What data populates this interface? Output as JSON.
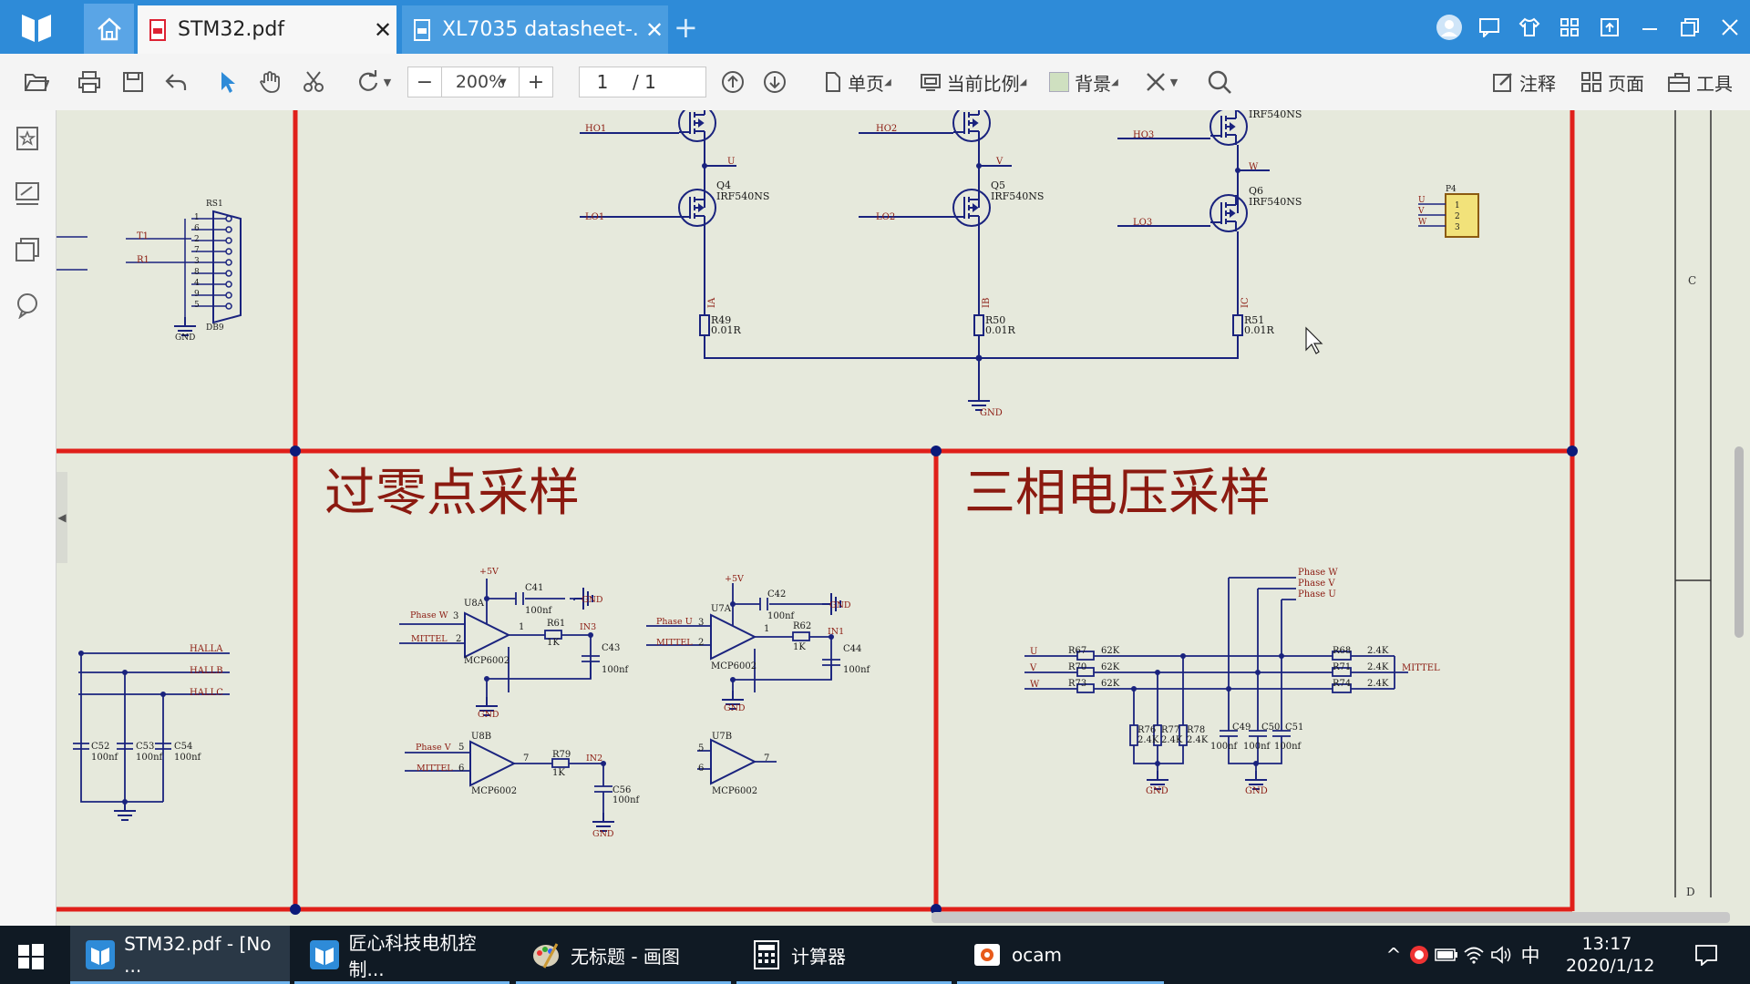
{
  "window": {
    "tabs": [
      {
        "label": "STM32.pdf",
        "active": true
      },
      {
        "label": "XL7035 datasheet-...",
        "active": false
      }
    ],
    "new_tab": "+"
  },
  "toolbar": {
    "zoom_value": "200%",
    "zoom_out": "−",
    "zoom_in": "+",
    "page_current": "1",
    "page_total": "/ 1",
    "single_page": "单页",
    "current_scale": "当前比例",
    "background": "背景",
    "annotate": "注释",
    "page": "页面",
    "tools": "工具"
  },
  "schematic": {
    "sections": {
      "zero_cross": "过零点采样",
      "three_phase": "三相电压采样"
    },
    "mosfets": [
      {
        "ref": "Q4",
        "part": "IRF540NS",
        "gate": "LO1",
        "node": "U"
      },
      {
        "ref": "Q5",
        "part": "IRF540NS",
        "gate": "LO2",
        "node": "V"
      },
      {
        "ref": "Q6",
        "part": "IRF540NS",
        "gate": "LO3",
        "node": "W"
      }
    ],
    "high_gates": [
      "HO1",
      "HO2",
      "HO3"
    ],
    "top_part_label": "IRF540NS",
    "shunts": [
      {
        "ref": "R49",
        "value": "0.01R",
        "net": "IA"
      },
      {
        "ref": "R50",
        "value": "0.01R",
        "net": "IB"
      },
      {
        "ref": "R51",
        "value": "0.01R",
        "net": "IC"
      }
    ],
    "gnd": "GND",
    "connector_db9": {
      "ref": "RS1",
      "part": "DB9",
      "pins": [
        "1",
        "6",
        "2",
        "7",
        "3",
        "8",
        "4",
        "9",
        "5"
      ],
      "t1": "T1",
      "r1": "R1"
    },
    "connector_p4": {
      "ref": "P4",
      "pins": [
        "1",
        "2",
        "3"
      ],
      "nets": [
        "U",
        "V",
        "W"
      ]
    },
    "hall": [
      "HALLA",
      "HALLB",
      "HALLC"
    ],
    "hall_caps": [
      {
        "ref": "C52",
        "value": "100nf"
      },
      {
        "ref": "C53",
        "value": "100nf"
      },
      {
        "ref": "C54",
        "value": "100nf"
      }
    ],
    "opamps": [
      {
        "ref": "U8A",
        "part": "MCP6002",
        "in_plus": "Phase W",
        "in_minus": "MITTEL",
        "pin_plus": "3",
        "pin_minus": "2",
        "out": "1",
        "r": "R61",
        "rv": "1K",
        "net": "IN3",
        "c": "C43",
        "cv": "100nf",
        "dec": "C41",
        "decv": "100nf"
      },
      {
        "ref": "U7A",
        "part": "MCP6002",
        "in_plus": "Phase U",
        "in_minus": "MITTEL",
        "pin_plus": "3",
        "pin_minus": "2",
        "out": "1",
        "r": "R62",
        "rv": "1K",
        "net": "IN1",
        "c": "C44",
        "cv": "100nf",
        "dec": "C42",
        "decv": "100nf"
      },
      {
        "ref": "U8B",
        "part": "MCP6002",
        "in_plus": "Phase V",
        "in_minus": "MITTEL",
        "pin_plus": "5",
        "pin_minus": "6",
        "out": "7",
        "r": "R79",
        "rv": "1K",
        "net": "IN2",
        "c": "C56",
        "cv": "100nf"
      },
      {
        "ref": "U7B",
        "part": "MCP6002",
        "pin_plus": "5",
        "pin_minus": "6",
        "out": "7"
      }
    ],
    "supply": "+5V",
    "three_phase": {
      "inputs": [
        "U",
        "V",
        "W"
      ],
      "r_in": [
        {
          "ref": "R67",
          "v": "62K"
        },
        {
          "ref": "R70",
          "v": "62K"
        },
        {
          "ref": "R73",
          "v": "62K"
        }
      ],
      "r_out": [
        {
          "ref": "R68",
          "v": "2.4K"
        },
        {
          "ref": "R71",
          "v": "2.4K"
        },
        {
          "ref": "R74",
          "v": "2.4K"
        }
      ],
      "r_gnd": [
        {
          "ref": "R76",
          "v": "2.4K"
        },
        {
          "ref": "R77",
          "v": "2.4K"
        },
        {
          "ref": "R78",
          "v": "2.4K"
        }
      ],
      "caps": [
        {
          "ref": "C49",
          "v": "100nf"
        },
        {
          "ref": "C50",
          "v": "100nf"
        },
        {
          "ref": "C51",
          "v": "100nf"
        }
      ],
      "phase_out": [
        "Phase W",
        "Phase V",
        "Phase U"
      ],
      "mittel": "MITTEL"
    },
    "border_markers": [
      "C",
      "D"
    ]
  },
  "taskbar": {
    "tasks": [
      {
        "label": "STM32.pdf - [No ..."
      },
      {
        "label": "匠心科技电机控制..."
      },
      {
        "label": "无标题 - 画图"
      },
      {
        "label": "计算器"
      },
      {
        "label": "ocam"
      }
    ],
    "ime": "中",
    "time": "13:17",
    "date": "2020/1/12"
  },
  "colors": {
    "titlebar": "#2e8bd8",
    "schematic_bg": "#e6e9dc",
    "wire": "#1a237e",
    "border": "#e0201a",
    "label": "#8b1a10",
    "taskbar": "#101a24"
  }
}
